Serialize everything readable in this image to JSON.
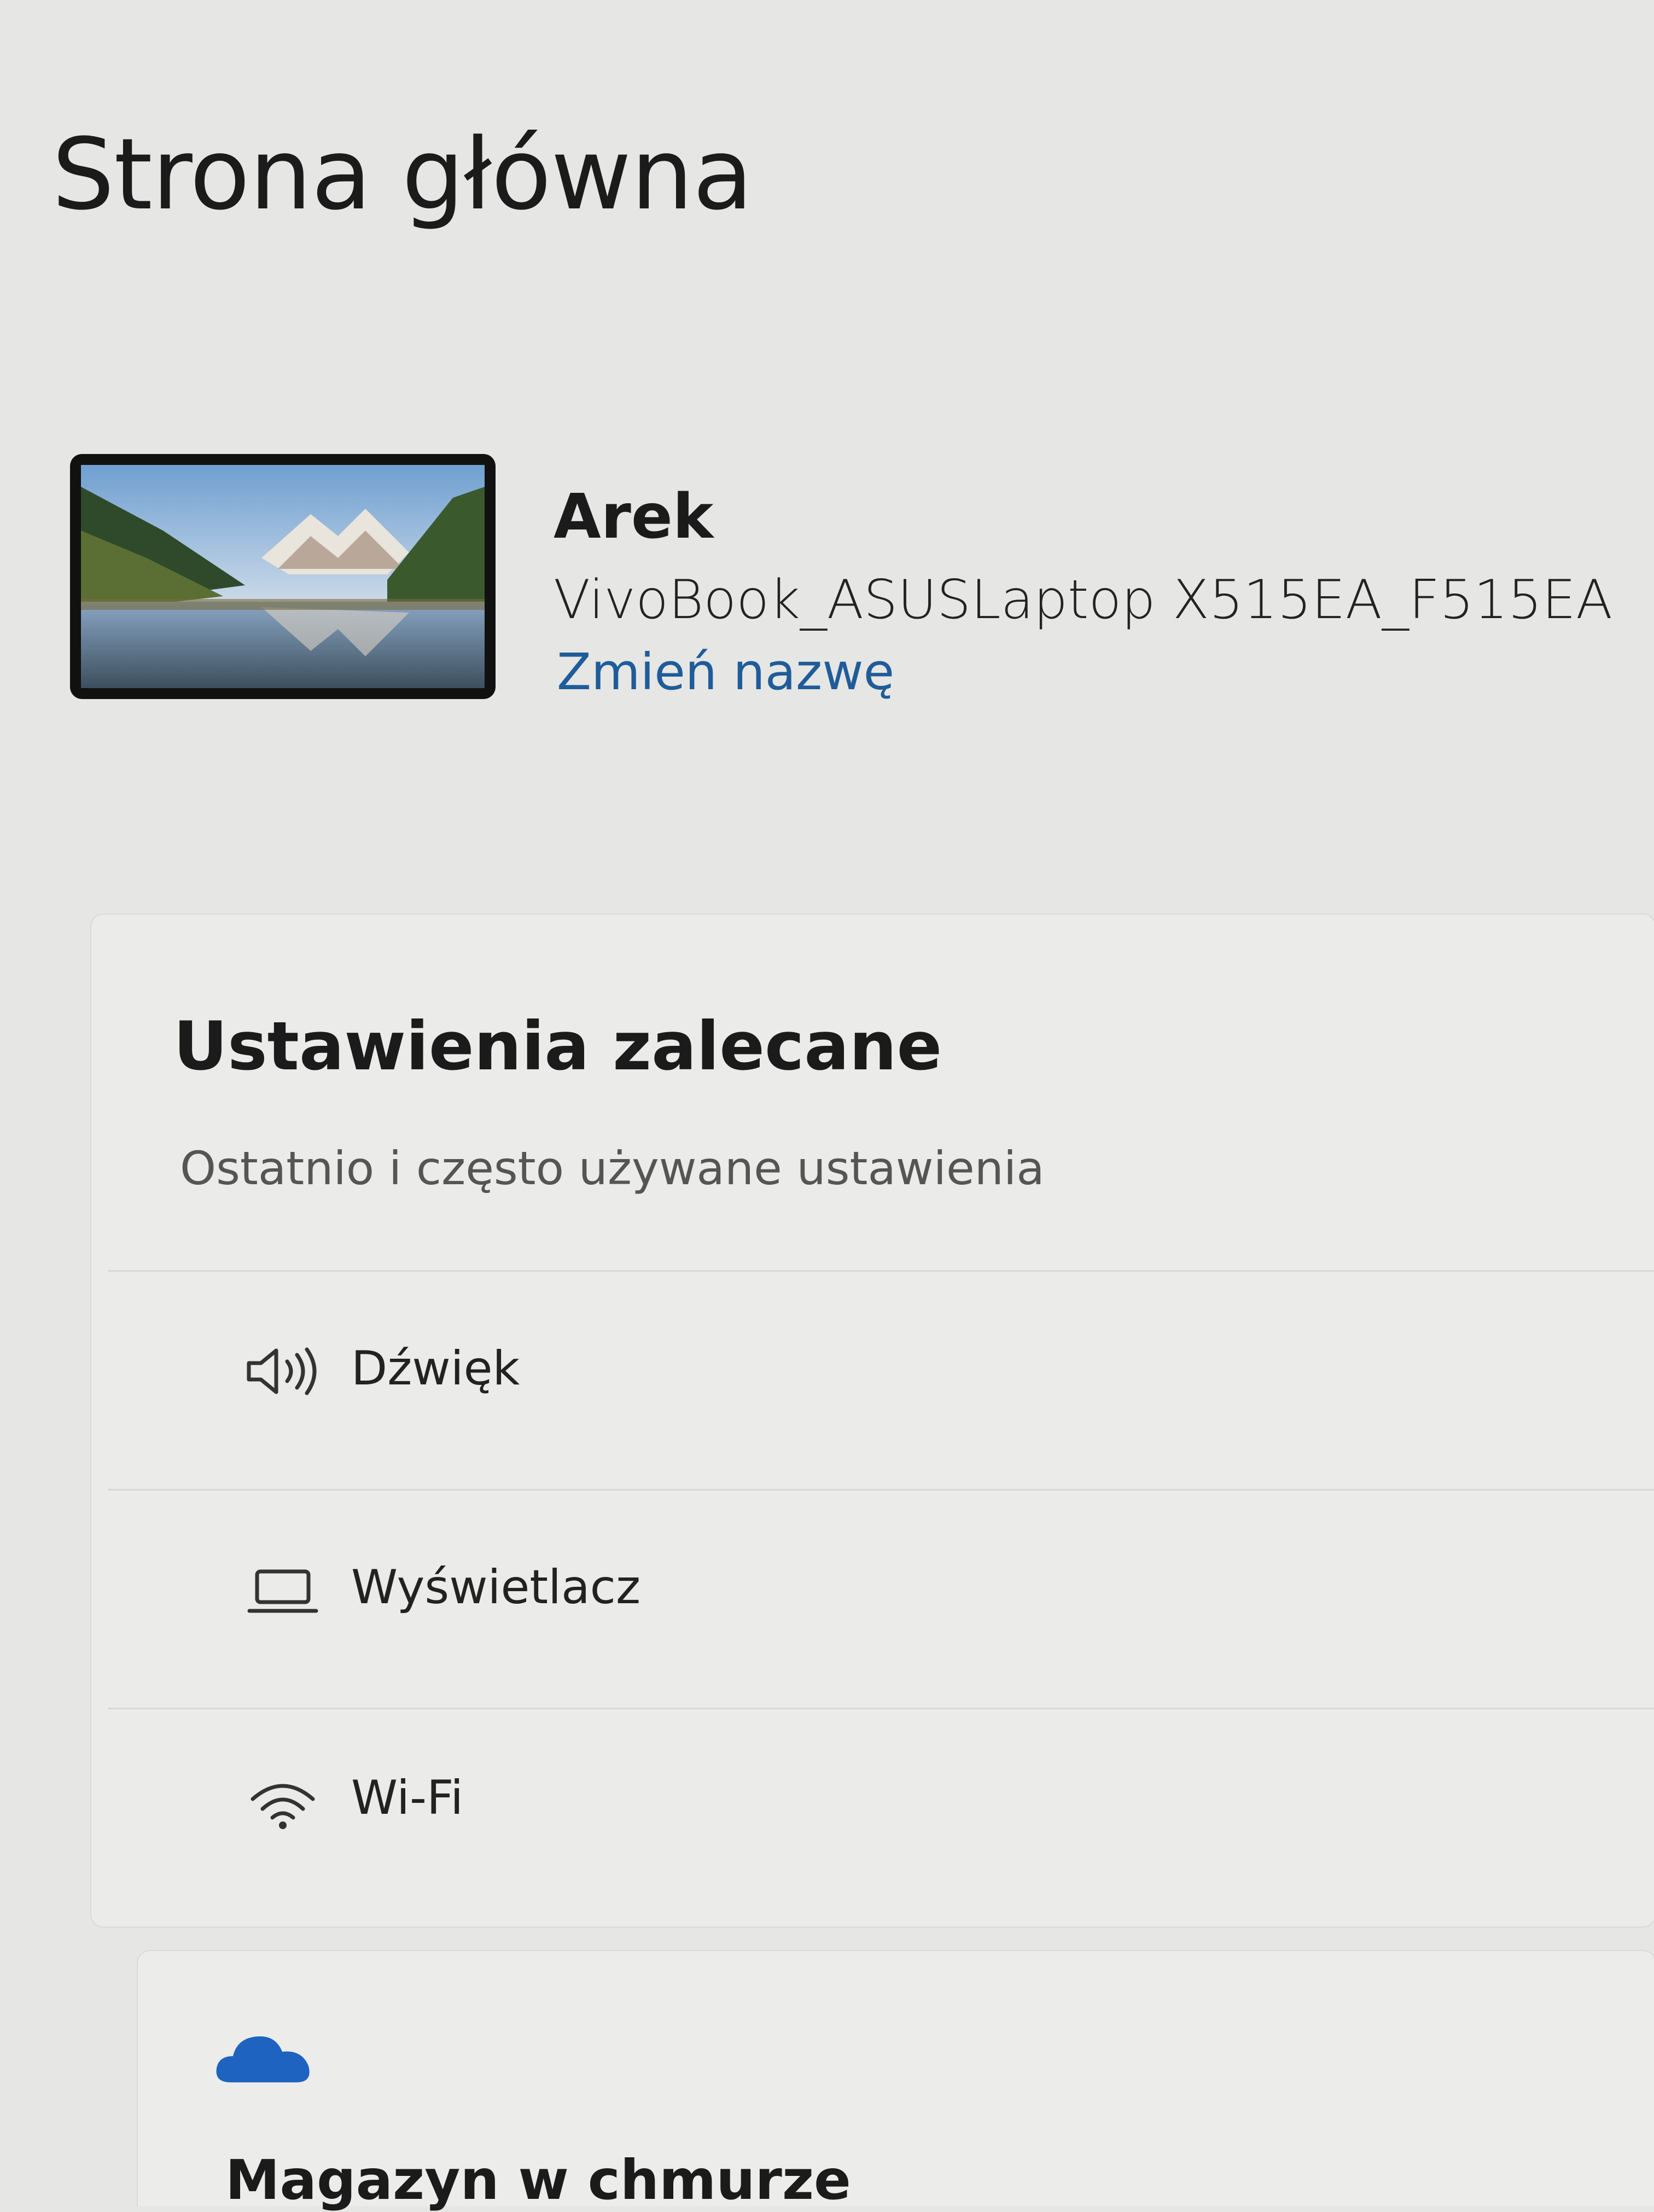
{
  "header": {
    "title": "Strona główna"
  },
  "account": {
    "name": "Arek",
    "device": "VivoBook_ASUSLaptop X515EA_F515EA",
    "rename_label": "Zmień nazwę"
  },
  "recommended": {
    "title": "Ustawienia zalecane",
    "subtitle": "Ostatnio i często używane ustawienia",
    "items": [
      {
        "label": "Dźwięk",
        "icon": "speaker-icon"
      },
      {
        "label": "Wyświetlacz",
        "icon": "laptop-icon"
      },
      {
        "label": "Wi-Fi",
        "icon": "wifi-icon"
      }
    ]
  },
  "cloud": {
    "title": "Magazyn w chmurze",
    "icon": "onedrive-cloud-icon",
    "icon_color": "#1e63c0"
  },
  "colors": {
    "accent_link": "#1f5c99",
    "background": "#e6e6e4"
  }
}
